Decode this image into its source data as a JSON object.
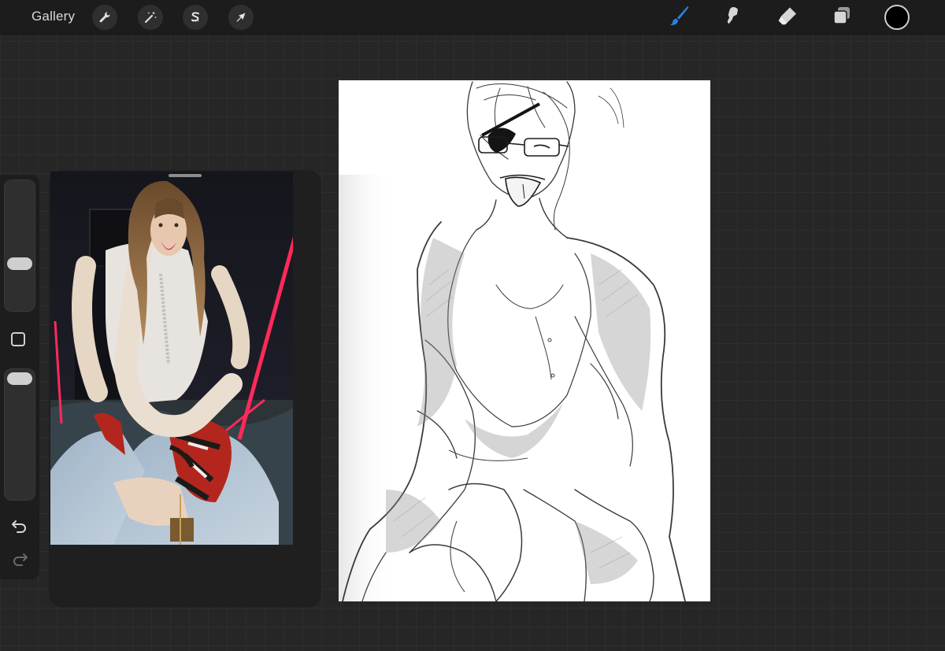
{
  "topbar": {
    "gallery_label": "Gallery",
    "left_tools": [
      {
        "icon": "wrench-icon",
        "name": "actions"
      },
      {
        "icon": "magic-wand-icon",
        "name": "adjustments"
      },
      {
        "icon": "selection-s-icon",
        "name": "selection"
      },
      {
        "icon": "arrow-cursor-icon",
        "name": "transform"
      }
    ],
    "right_tools": [
      {
        "icon": "brush-icon",
        "name": "brush",
        "active": true
      },
      {
        "icon": "smudge-icon",
        "name": "smudge",
        "active": false
      },
      {
        "icon": "eraser-icon",
        "name": "eraser",
        "active": false
      },
      {
        "icon": "layers-icon",
        "name": "layers",
        "active": false
      }
    ],
    "current_color": "#000000"
  },
  "sidebar": {
    "brush_size_level": 0.5,
    "opacity_level": 0.95,
    "modify_icon": "square-icon",
    "undo_icon": "undo-icon",
    "redo_icon": "redo-icon"
  },
  "colors": {
    "active_tool": "#2f7fe0",
    "inactive_tool": "#d6d6d6",
    "topbar": "#1c1c1c",
    "canvas_bg": "#262626",
    "neon_accent": "#ff2a5a"
  }
}
